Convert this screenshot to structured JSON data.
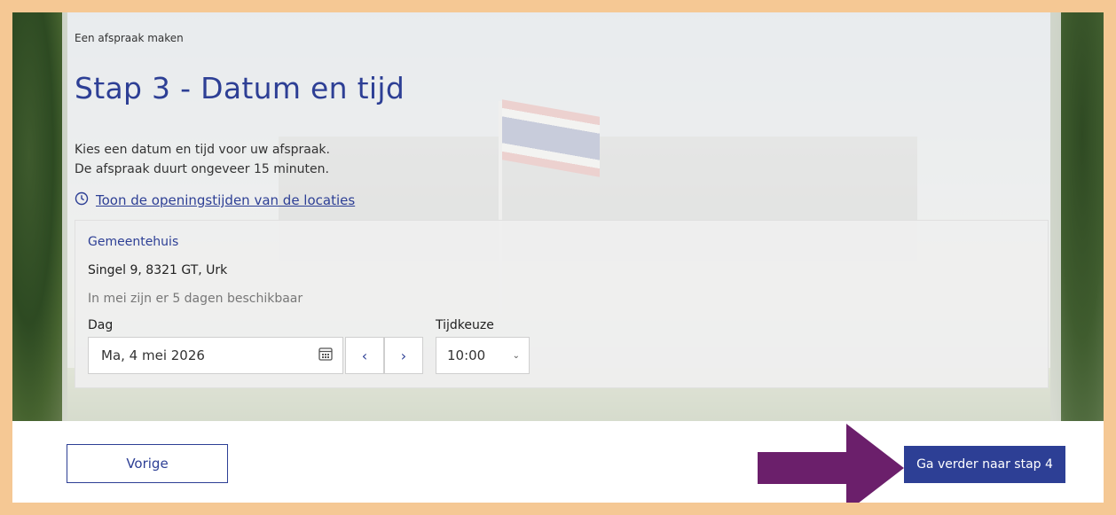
{
  "breadcrumb": "Een afspraak maken",
  "page_title": "Stap 3 - Datum en tijd",
  "intro": {
    "line1": "Kies een datum en tijd voor uw afspraak.",
    "line2": "De afspraak duurt ongeveer 15 minuten."
  },
  "hours_link": {
    "label": "Toon de openingstijden van de locaties",
    "icon": "clock-icon"
  },
  "location": {
    "name": "Gemeentehuis",
    "address": "Singel 9, 8321 GT, Urk",
    "availability": "In mei zijn er 5 dagen beschikbaar"
  },
  "day": {
    "label": "Dag",
    "value": "Ma, 4 mei 2026",
    "icon": "calendar-icon",
    "prev_symbol": "‹",
    "next_symbol": "›"
  },
  "time": {
    "label": "Tijdkeuze",
    "value": "10:00",
    "chevron": "⌄"
  },
  "buttons": {
    "previous": "Vorige",
    "next": "Ga verder naar stap 4"
  },
  "colors": {
    "brand": "#2d3f95",
    "frame": "#f5c894",
    "arrow": "#6b1f6b"
  }
}
